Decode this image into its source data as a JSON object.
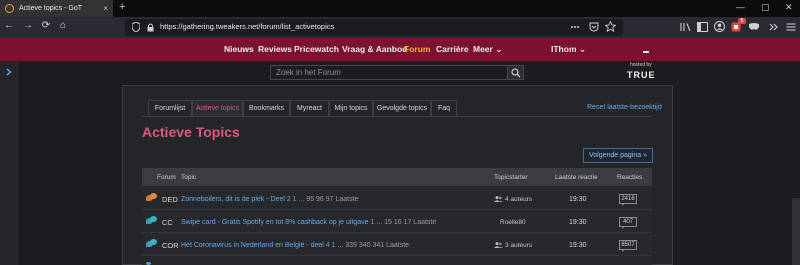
{
  "browser": {
    "tab_title": "Actieve topics - GoT",
    "tab_close": "×",
    "new_tab": "+",
    "url": "https://gathering.tweakers.net/forum/list_activetopics",
    "window_controls": [
      "—",
      "▢",
      "✕"
    ],
    "badge_count": "5",
    "nav_buttons": [
      "←",
      "→",
      "⟳",
      "⌂"
    ]
  },
  "site_nav": {
    "items": [
      {
        "label": "Nieuws",
        "active": false
      },
      {
        "label": "Reviews",
        "active": false
      },
      {
        "label": "Pricewatch",
        "active": false
      },
      {
        "label": "Vraag & Aanbod",
        "active": false
      },
      {
        "label": "Forum",
        "active": true
      },
      {
        "label": "Carrière",
        "active": false
      },
      {
        "label": "Meer ⌄",
        "active": false
      }
    ],
    "user": "IThom ⌄"
  },
  "search": {
    "placeholder": "Zoek in het Forum"
  },
  "hosted": {
    "label": "hosted by",
    "brand": "TRUE"
  },
  "subtabs": [
    {
      "label": "Forumlijst",
      "active": false
    },
    {
      "label": "Actieve topics",
      "active": true
    },
    {
      "label": "Bookmarks",
      "active": false
    },
    {
      "label": "Myreact",
      "active": false
    },
    {
      "label": "Mijn topics",
      "active": false
    },
    {
      "label": "Gevolgde topics",
      "active": false
    },
    {
      "label": "Faq",
      "active": false
    }
  ],
  "reset_link": "Reset laatste-bezoektijd",
  "page_title": "Actieve Topics",
  "next_page": "Volgende pagina »",
  "table": {
    "headers": {
      "forum": "Forum",
      "topic": "Topic",
      "starter": "Topicstarter",
      "last": "Laatste reactie",
      "replies": "Reacties"
    },
    "rows": [
      {
        "code": "DED",
        "title": "Zonneboilers, dit is de plek - Deel 2",
        "pages": " 1 ... 95 96 97 Laatste",
        "starter": "4 auteurs",
        "starter_multi": true,
        "time": "19:30",
        "replies": "2416",
        "icon_color": "#e8843b"
      },
      {
        "code": "CC",
        "title": "Swipe card - Gratis Spotify en tot 8% cashback op je uitgave",
        "pages": " 1 ... 15 16 17 Laatste",
        "starter": "Roelle80",
        "starter_multi": false,
        "time": "19:30",
        "replies": "407",
        "icon_color": "#3ab0c8"
      },
      {
        "code": "COR",
        "title": "Het Coronavirus in Nederland en België - deel 4",
        "pages": " 1 ... 339 340 341 Laatste",
        "starter": "3 auteurs",
        "starter_multi": true,
        "time": "19:30",
        "replies": "8507",
        "icon_color": "#3ab0c8"
      }
    ]
  },
  "colors": {
    "accent": "#e4557d",
    "brand_bar": "#7b1230",
    "link": "#6aa9e6",
    "active_nav": "#f3b436"
  }
}
